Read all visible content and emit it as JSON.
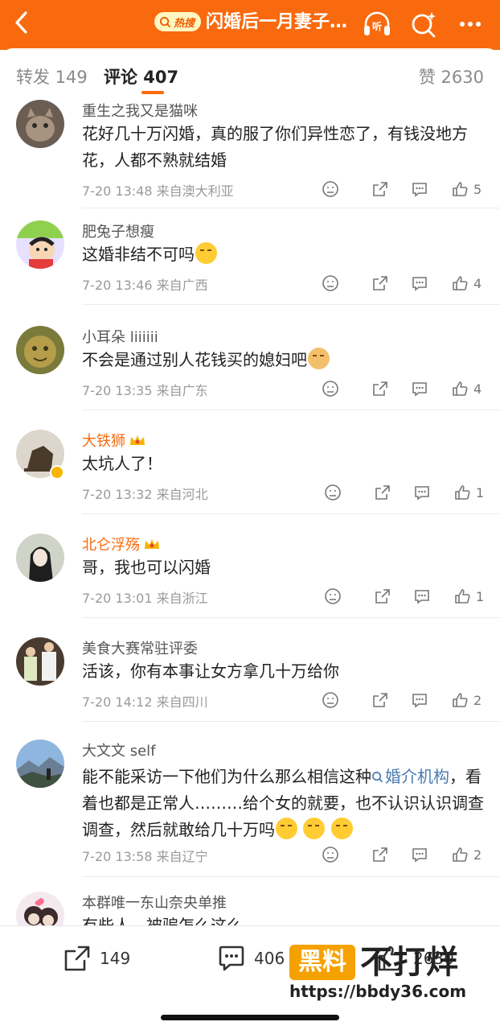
{
  "header": {
    "hot_badge": "热搜",
    "title": "闪婚后一月妻子离家出走",
    "colors": {
      "brand": "#f96a0e",
      "badge_bg": "#fff7c2"
    },
    "icons": [
      "back-chevron-icon",
      "search-icon",
      "listen-icon",
      "ai-search-icon",
      "more-icon"
    ]
  },
  "tabs": {
    "repost": "转发 149",
    "comment": "评论 407",
    "likes": "赞 2630"
  },
  "comments": [
    {
      "user": "重生之我又是猫咪",
      "text": "花好几十万闪婚，真的服了你们异性恋了，有钱没地方花，人都不熟就结婚",
      "meta": "7-20 13:48  来自澳大利亚",
      "likes": "5"
    },
    {
      "user": "肥兔子想瘦",
      "text": "这婚非结不可吗",
      "meta": "7-20 13:46  来自广西",
      "likes": "4"
    },
    {
      "user": "小耳朵 liiiiii",
      "text": "不会是通过别人花钱买的媳妇吧",
      "meta": "7-20 13:35  来自广东",
      "likes": "4"
    },
    {
      "user": "大铁狮",
      "text": "太坑人了！",
      "meta": "7-20 13:32  来自河北",
      "likes": "1"
    },
    {
      "user": "北仑浮殇",
      "text": "哥，我也可以闪婚",
      "meta": "7-20 13:01  来自浙江",
      "likes": "1"
    },
    {
      "user": "美食大赛常驻评委",
      "text": "活该，你有本事让女方拿几十万给你",
      "meta": "7-20 14:12  来自四川",
      "likes": "2"
    },
    {
      "user": "大文文 self",
      "text_a": "能不能采访一下他们为什么那么相信这种",
      "keyword": "婚介机构",
      "text_b": "，看着也都是正常人………给个女的就要，也不认识认识调查调查，然后就敢给几十万吗",
      "meta": "7-20 13:58  来自辽宁",
      "likes": "2"
    },
    {
      "user": "本群唯一东山奈央单推",
      "text": "有些人，被骗怎么这么"
    }
  ],
  "bottom": {
    "repost_count": "149",
    "comment_count": "406",
    "like_count": "2630"
  },
  "watermark": {
    "box": "黑料",
    "text": "不打烊",
    "url": "https://bbdy36.com"
  }
}
